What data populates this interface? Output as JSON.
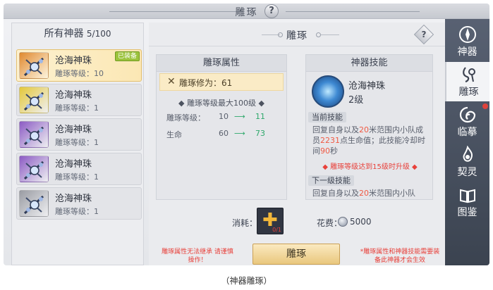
{
  "top_bar": {
    "title": "雕琢",
    "help": "?"
  },
  "list": {
    "title": "所有神器",
    "count": "5/100",
    "items": [
      {
        "name": "沧海神珠",
        "level": "雕琢等级：10",
        "badge": "已装备",
        "selected": true,
        "color": "#e0892f"
      },
      {
        "name": "沧海神珠",
        "level": "雕琢等级：1",
        "badge": "",
        "selected": false,
        "color": "#e4c83a"
      },
      {
        "name": "沧海神珠",
        "level": "雕琢等级：1",
        "badge": "",
        "selected": false,
        "color": "#8c5bc4"
      },
      {
        "name": "沧海神珠",
        "level": "雕琢等级：1",
        "badge": "",
        "selected": false,
        "color": "#8c5bc4"
      },
      {
        "name": "沧海神珠",
        "level": "雕琢等级：1",
        "badge": "",
        "selected": false,
        "color": "#9a9ca3"
      }
    ]
  },
  "main": {
    "title": "雕琢",
    "help": "?"
  },
  "attributes": {
    "title": "雕琢属性",
    "cultivation": "雕琢修为：61",
    "max_level": "◆ 雕琢等级最大100级 ◆",
    "rows": [
      {
        "label": "雕琢等级：",
        "from": "10",
        "arrow": "⟶",
        "to": "11"
      },
      {
        "label": "生命",
        "from": "60",
        "arrow": "⟶",
        "to": "73"
      }
    ]
  },
  "skill": {
    "title": "神器技能",
    "name": "沧海神珠",
    "level": "2级",
    "current_label": "当前技能",
    "current_desc": {
      "p1": "回复自身以及",
      "n1": "20",
      "p2": "米范围内小队成员",
      "n2": "2231",
      "p3": "点生命值；此技能冷却时间",
      "n3": "90",
      "p4": "秒"
    },
    "upgrade_note": "◆ 雕琢等级达到15级时升级 ◆",
    "next_label": "下一级技能",
    "next_desc": {
      "p1": "回复自身以及",
      "n1": "20",
      "p2": "米范围内小队"
    }
  },
  "cost": {
    "label": "消耗：",
    "item_qty": "0/1",
    "fee_label": "花费：",
    "fee_value": "5000"
  },
  "notes": {
    "left": "雕琢属性无法继承 请谨慎操作！",
    "right": "*雕琢属性和神器技能需要装备此神器才会生效"
  },
  "button_label": "雕琢",
  "nav": [
    {
      "label": "神器",
      "active": false,
      "icon": "artifact-icon"
    },
    {
      "label": "雕琢",
      "active": true,
      "icon": "carve-icon"
    },
    {
      "label": "临摹",
      "active": false,
      "icon": "copy-swirl-icon",
      "dot": true
    },
    {
      "label": "契灵",
      "active": false,
      "icon": "spirit-flame-icon"
    },
    {
      "label": "图鉴",
      "active": false,
      "icon": "book-icon"
    }
  ],
  "caption": "（神器雕琢）",
  "colors": {
    "increase": "#2ea86b",
    "warning": "#e8413b",
    "highlight": "#f05a44",
    "equipped_badge": "#9cc33c"
  }
}
